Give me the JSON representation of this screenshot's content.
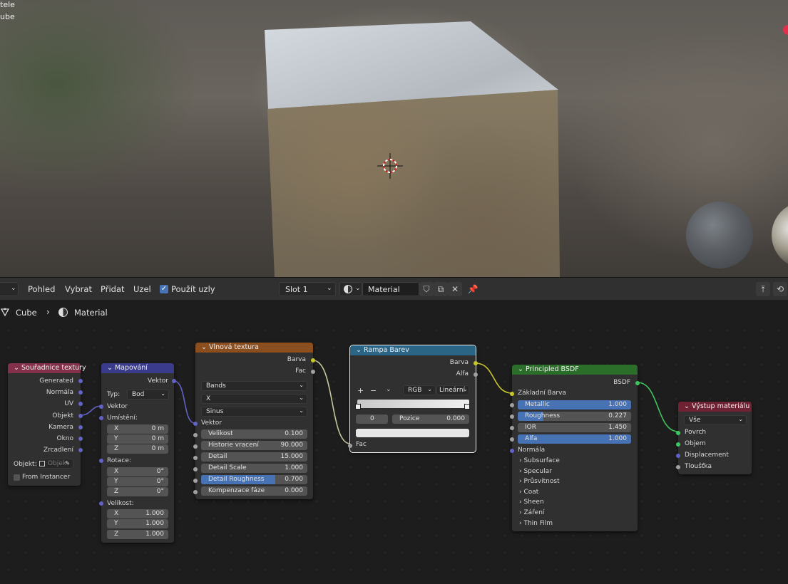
{
  "viewport": {
    "overlay_line1": "tele",
    "overlay_line2": "ube"
  },
  "header": {
    "menu": [
      "Pohled",
      "Vybrat",
      "Přidat",
      "Uzel"
    ],
    "use_nodes_label": "Použít uzly",
    "slot_label": "Slot 1",
    "material_name": "Material"
  },
  "breadcrumb": {
    "object": "Cube",
    "material": "Material"
  },
  "nodes": {
    "tex_coord": {
      "title": "Souřadnice textury",
      "outputs": [
        "Generated",
        "Normála",
        "UV",
        "Objekt",
        "Kamera",
        "Okno",
        "Zrcadlení"
      ],
      "object_label": "Objekt:",
      "object_placeholder": "Objek",
      "from_instancer": "From Instancer",
      "color": "#83314a"
    },
    "mapping": {
      "title": "Mapování",
      "output": "Vektor",
      "type_label": "Typ:",
      "type_value": "Bod",
      "input_vector": "Vektor",
      "location_label": "Umístění:",
      "location": [
        {
          "axis": "X",
          "value": "0 m"
        },
        {
          "axis": "Y",
          "value": "0 m"
        },
        {
          "axis": "Z",
          "value": "0 m"
        }
      ],
      "rotation_label": "Rotace:",
      "rotation": [
        {
          "axis": "X",
          "value": "0°"
        },
        {
          "axis": "Y",
          "value": "0°"
        },
        {
          "axis": "Z",
          "value": "0°"
        }
      ],
      "scale_label": "Velikost:",
      "scale": [
        {
          "axis": "X",
          "value": "1.000"
        },
        {
          "axis": "Y",
          "value": "1.000"
        },
        {
          "axis": "Z",
          "value": "1.000"
        }
      ],
      "color": "#3b3b8c"
    },
    "wave": {
      "title": "Vlnová textura",
      "out_color": "Barva",
      "out_fac": "Fac",
      "drop1": "Bands",
      "drop2": "X",
      "drop3": "Sinus",
      "input_vector": "Vektor",
      "fields": [
        {
          "label": "Velikost",
          "value": "0.100"
        },
        {
          "label": "Historie vracení",
          "value": "90.000"
        },
        {
          "label": "Detail",
          "value": "15.000"
        },
        {
          "label": "Detail Scale",
          "value": "1.000"
        },
        {
          "label": "Detail Roughness",
          "value": "0.700",
          "fill": 0.7
        },
        {
          "label": "Kompenzace fáze",
          "value": "0.000"
        }
      ],
      "color": "#8a4e1f"
    },
    "ramp": {
      "title": "Rampa Barev",
      "out_color": "Barva",
      "out_alpha": "Alfa",
      "mode": "RGB",
      "interp": "Lineární",
      "index": "0",
      "position_label": "Pozice",
      "position_value": "0.000",
      "input_fac": "Fac",
      "color": "#2b6585"
    },
    "bsdf": {
      "title": "Principled BSDF",
      "output": "BSDF",
      "base_color": "Základní Barva",
      "fields": [
        {
          "label": "Metallic",
          "value": "1.000",
          "fill": 1.0
        },
        {
          "label": "Roughness",
          "value": "0.227",
          "fill": 0.227
        },
        {
          "label": "IOR",
          "value": "1.450",
          "fill": 0.0
        },
        {
          "label": "Alfa",
          "value": "1.000",
          "fill": 1.0
        }
      ],
      "normal": "Normála",
      "subpanels": [
        "Subsurface",
        "Specular",
        "Průsvitnost",
        "Coat",
        "Sheen",
        "Záření",
        "Thin Film"
      ],
      "color": "#2a6e2a"
    },
    "output": {
      "title": "Výstup materiálu",
      "target": "Vše",
      "inputs": [
        "Povrch",
        "Objem",
        "Displacement",
        "Tloušťka"
      ],
      "color": "#6e2233"
    }
  }
}
